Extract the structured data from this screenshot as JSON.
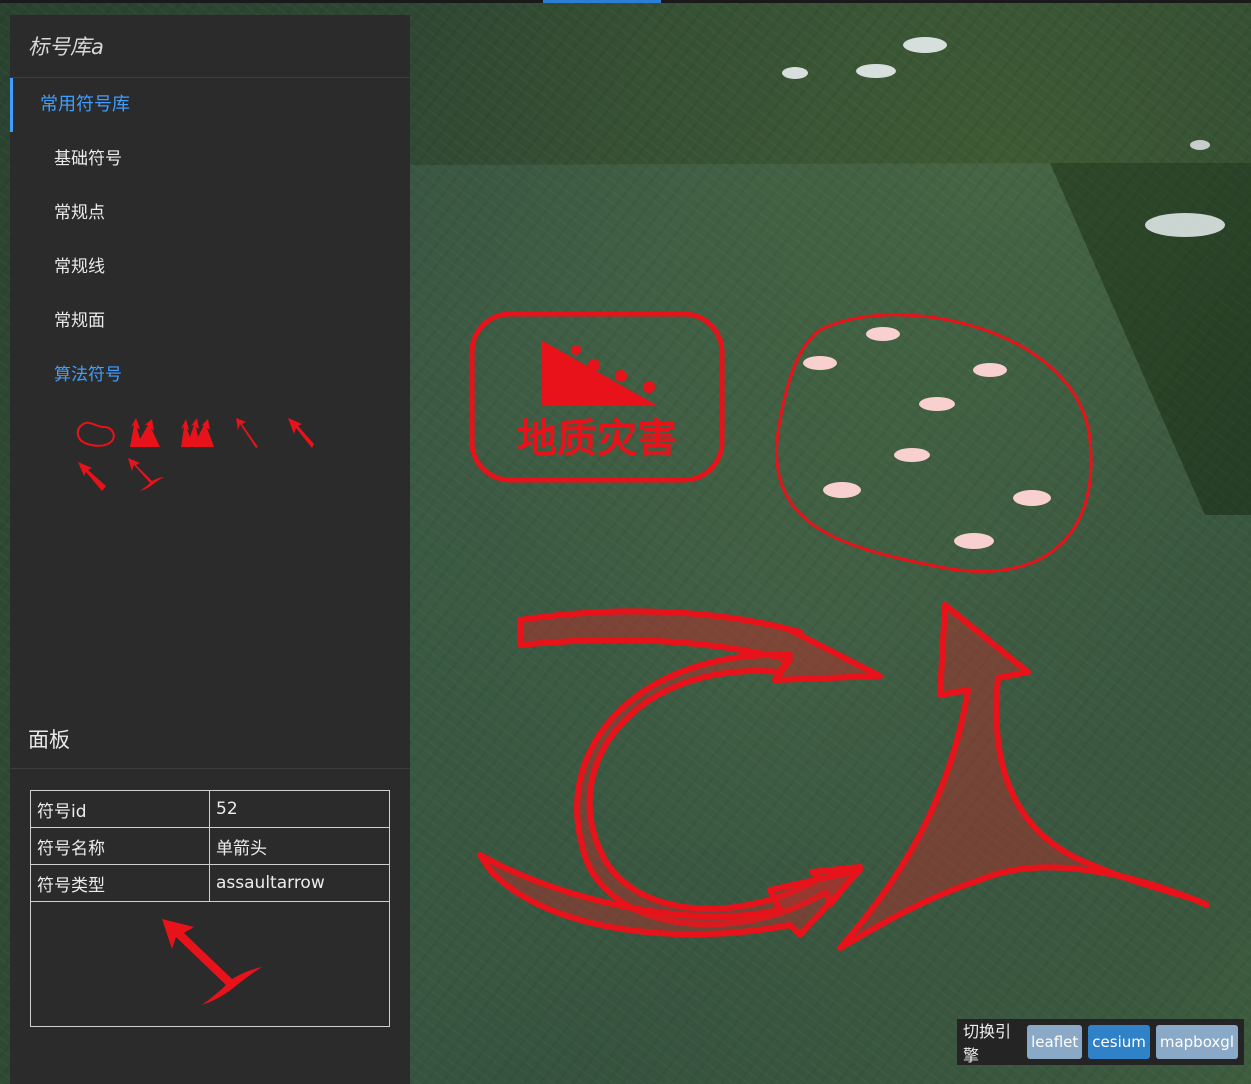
{
  "sidebar": {
    "library_title": "标号库a",
    "menu_head": "常用符号库",
    "menu_items": [
      {
        "label": "基础符号",
        "active": false
      },
      {
        "label": "常规点",
        "active": false
      },
      {
        "label": "常规线",
        "active": false
      },
      {
        "label": "常规面",
        "active": false
      },
      {
        "label": "算法符号",
        "active": true
      }
    ],
    "algorithm_symbols": [
      "closed-curve-icon",
      "double-arrow-icon",
      "triple-arrow-icon",
      "thin-arrow-icon",
      "straight-arrow-icon",
      "fine-arrow-icon",
      "assault-arrow-icon"
    ]
  },
  "panel": {
    "title": "面板",
    "rows": [
      {
        "key": "符号id",
        "value": "52"
      },
      {
        "key": "符号名称",
        "value": "单箭头"
      },
      {
        "key": "符号类型",
        "value": "assaultarrow"
      }
    ]
  },
  "map": {
    "stamp_text": "地质灾害"
  },
  "engine": {
    "label": "切换引擎",
    "buttons": [
      {
        "label": "leaflet",
        "active": false
      },
      {
        "label": "cesium",
        "active": true
      },
      {
        "label": "mapboxgl",
        "active": false
      }
    ]
  },
  "colors": {
    "accent": "#409eff",
    "symbol_red": "#e8121a",
    "panel_bg": "#2b2b2c"
  }
}
